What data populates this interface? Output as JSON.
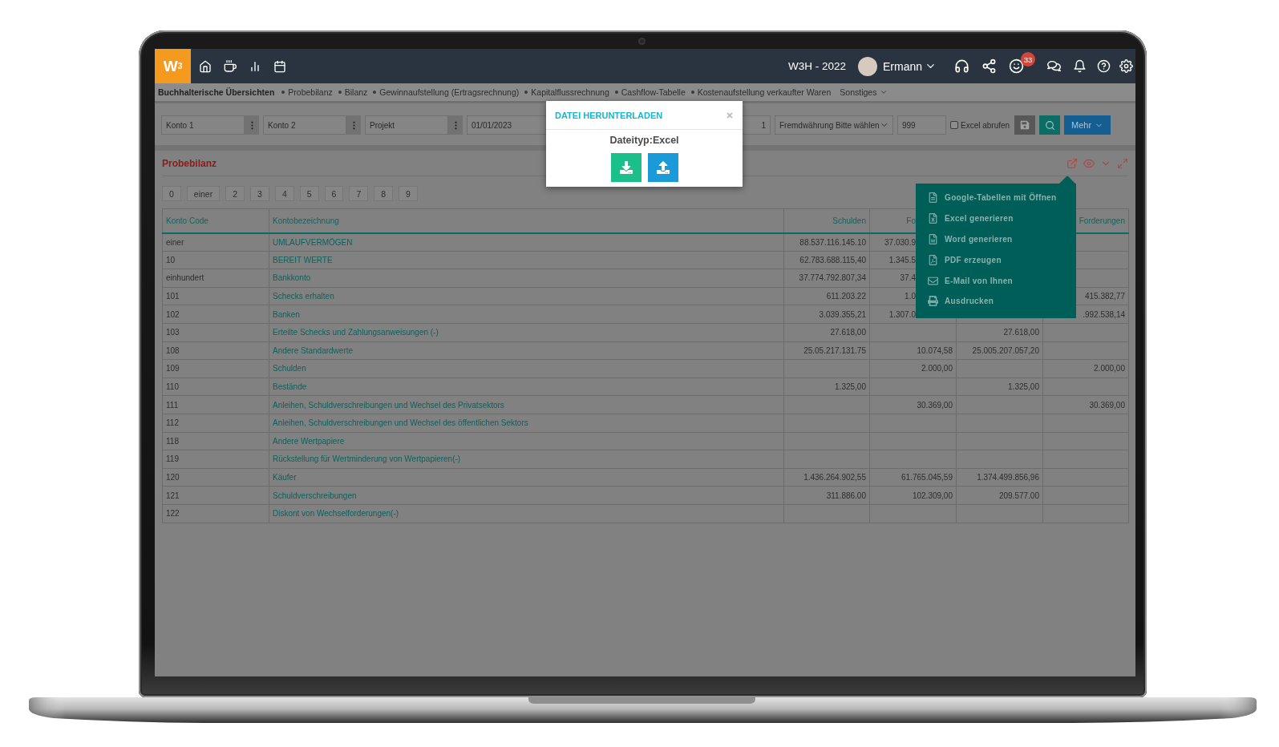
{
  "topbar": {
    "logo": "W$^{3}$",
    "company": "W3H - 2022",
    "user": "Ermann",
    "notifications": "33"
  },
  "nav": {
    "title": "Buchhalterische Übersichten",
    "links": [
      "Probebilanz",
      "Bilanz",
      "Gewinnaufstellung (Ertragsrechnung)",
      "Kapitalflussrechnung",
      "Cashflow-Tabelle",
      "Kostenaufstellung verkaufter Waren"
    ],
    "more": "Sonstiges"
  },
  "filters": {
    "fields": [
      {
        "kind": "picker",
        "placeholder": "Konto 1"
      },
      {
        "kind": "picker",
        "placeholder": "Konto 2"
      },
      {
        "kind": "picker",
        "placeholder": "Projekt"
      },
      {
        "kind": "date",
        "value": "01/01/2023"
      },
      {
        "kind": "number",
        "value": "1"
      },
      {
        "kind": "select",
        "value": "Fremdwährung Bitte wählen"
      },
      {
        "kind": "text",
        "value": "999"
      }
    ],
    "checkbox": {
      "label": "Excel abrufen",
      "checked": false
    },
    "buttons": [
      {
        "kind": "save"
      },
      {
        "kind": "search"
      },
      {
        "kind": "menu",
        "label": "Mehr"
      }
    ]
  },
  "report": {
    "title": "Probebilanz",
    "actions": [
      {
        "kind": "export"
      },
      {
        "kind": "view"
      },
      {
        "kind": "collapse"
      },
      {
        "kind": "expand"
      }
    ],
    "index_filters": [
      "0",
      "einer",
      "2",
      "3",
      "4",
      "5",
      "6",
      "7",
      "8",
      "9"
    ]
  },
  "table": {
    "columns": {
      "konto_code": "Konto Code",
      "kontobezeichnung": "Kontobezeichnung",
      "schulden": "Schulden",
      "column_4": "Fo",
      "forderungen": "Forderungen"
    },
    "rows": [
      {
        "konto_code": "einer",
        "kontobezeichnung": "UMLAUFVERMÖGEN",
        "schulden": "88.537.116.145.10",
        "column_4": "37.030.9"
      },
      {
        "konto_code": "10",
        "kontobezeichnung": "BEREIT WERTE",
        "schulden": "62.783.688.115,40",
        "column_4": "1.345.5"
      },
      {
        "konto_code": "einhundert",
        "kontobezeichnung": "Bankkonto",
        "schulden": "37.774.792.807,34",
        "column_4": "37.4"
      },
      {
        "konto_code": "101",
        "kontobezeichnung": "Schecks erhalten",
        "schulden": "611.203.22",
        "column_4": "1.0",
        "forderungen": "415.382,77"
      },
      {
        "konto_code": "102",
        "kontobezeichnung": "Banken",
        "schulden": "3.039.355,21",
        "column_4": "1.307.0",
        "forderungen": ".992.538,14"
      },
      {
        "konto_code": "103",
        "kontobezeichnung": "Erteilte Schecks und Zahlungsanweisungen (-)",
        "schulden": "27.618,00",
        "column_5": "27.618,00"
      },
      {
        "konto_code": "108",
        "kontobezeichnung": "Andere Standardwerte",
        "schulden": "25.05.217.131.75",
        "column_4": "10.074,58",
        "column_5": "25.005.207.057,20"
      },
      {
        "konto_code": "109",
        "kontobezeichnung": "Schulden",
        "column_4": "2.000,00",
        "forderungen": "2.000,00"
      },
      {
        "konto_code": "110",
        "kontobezeichnung": "Bestände",
        "schulden": "1.325,00",
        "column_5": "1.325,00"
      },
      {
        "konto_code": "111",
        "kontobezeichnung": "Anleihen, Schuldverschreibungen und Wechsel des Privatsektors",
        "column_4": "30.369,00",
        "forderungen": "30.369,00"
      },
      {
        "konto_code": "112",
        "kontobezeichnung": "Anleihen, Schuldverschreibungen und Wechsel des öffentlichen Sektors"
      },
      {
        "konto_code": "118",
        "kontobezeichnung": "Andere Wertpapiere"
      },
      {
        "konto_code": "119",
        "kontobezeichnung": "Rückstellung für Wertminderung von Wertpapieren(-)"
      },
      {
        "konto_code": "120",
        "kontobezeichnung": "Käufer",
        "schulden": "1.436.264.902,55",
        "column_4": "61.765.045,59",
        "column_5": "1.374.499.856,96"
      },
      {
        "konto_code": "121",
        "kontobezeichnung": "Schuldverschreibungen",
        "schulden": "311.886.00",
        "column_4": "102.309,00",
        "column_5": "209.577.00"
      },
      {
        "konto_code": "122",
        "kontobezeichnung": "Diskont von Wechselforderungen(-)"
      }
    ]
  },
  "download_dialog": {
    "title": "DATEI HERUNTERLADEN",
    "file_type": "Dateityp:Excel",
    "buttons": [
      {
        "kind": "download"
      },
      {
        "kind": "upload"
      }
    ]
  },
  "export_menu": {
    "items": [
      {
        "kind": "sheet",
        "label": "Google-Tabellen mit Öffnen"
      },
      {
        "kind": "excel",
        "label": "Excel generieren"
      },
      {
        "kind": "word",
        "label": "Word generieren"
      },
      {
        "kind": "pdf",
        "label": "PDF erzeugen"
      },
      {
        "kind": "mail",
        "label": "E-Mail von Ihnen"
      },
      {
        "kind": "print",
        "label": "Ausdrucken"
      }
    ]
  }
}
